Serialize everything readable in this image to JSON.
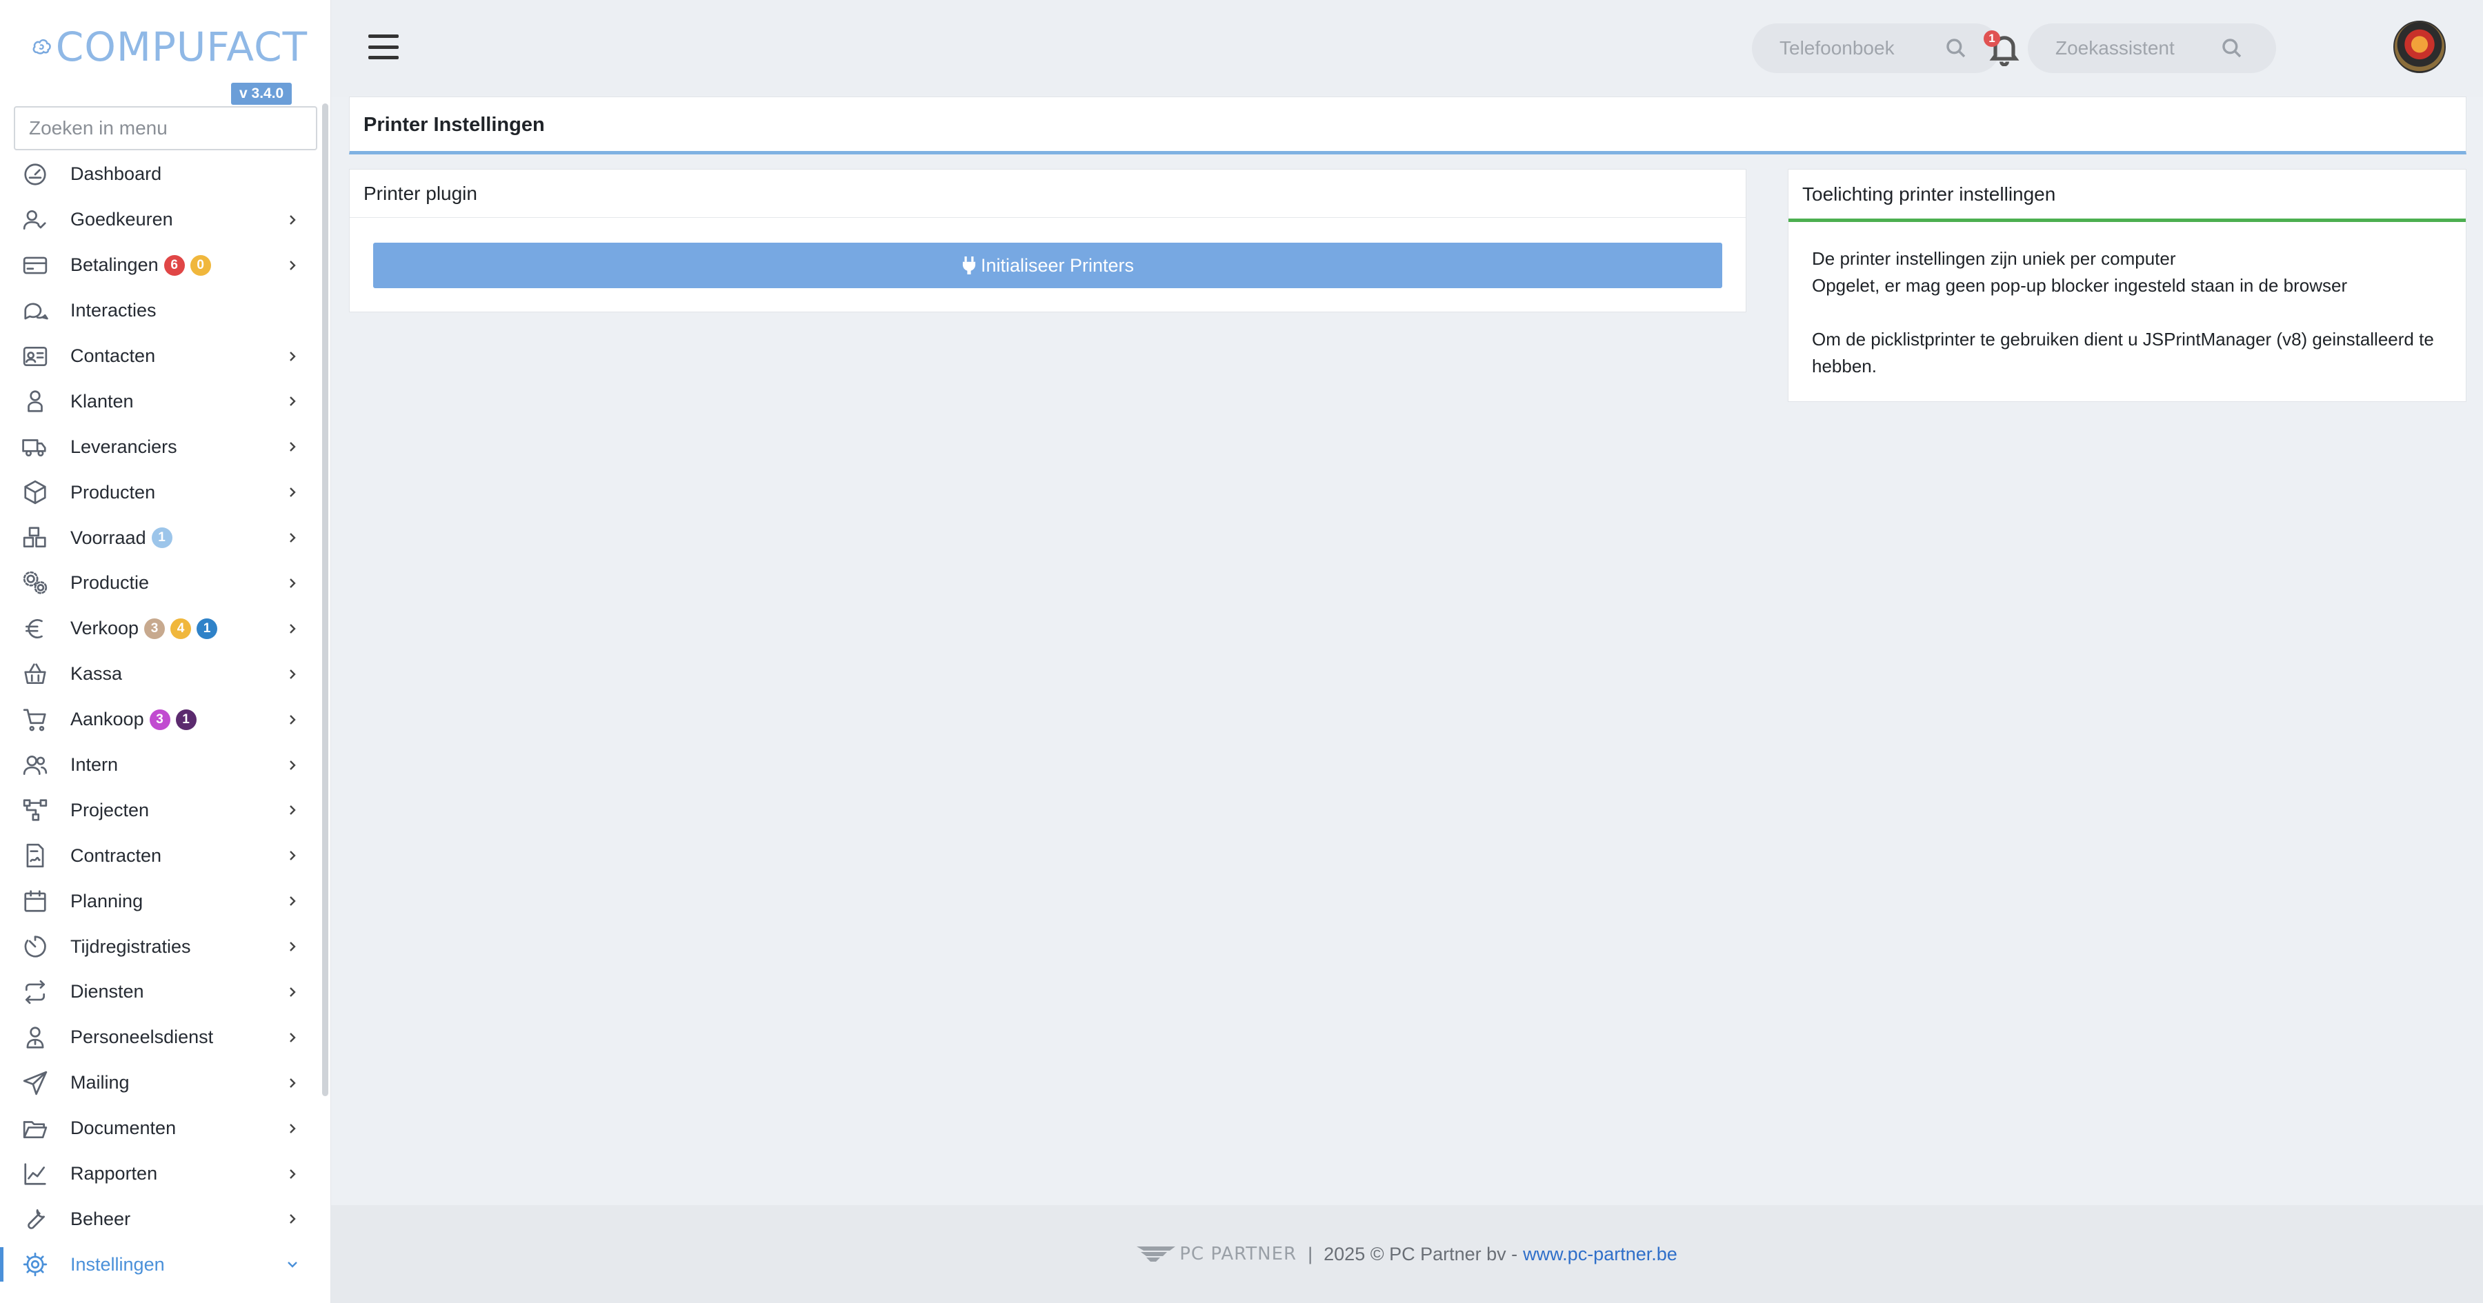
{
  "app": {
    "logo_text": "COMPUFACT",
    "version": "v 3.4.0"
  },
  "sidebar": {
    "search_placeholder": "Zoeken in menu",
    "items": [
      {
        "label": "Dashboard",
        "icon": "dashboard-gauge-icon",
        "chevron": false,
        "badges": []
      },
      {
        "label": "Goedkeuren",
        "icon": "user-check-icon",
        "chevron": true,
        "badges": []
      },
      {
        "label": "Betalingen",
        "icon": "credit-card-icon",
        "chevron": true,
        "badges": [
          {
            "text": "6",
            "color": "#e04646"
          },
          {
            "text": "0",
            "color": "#f0b73c"
          }
        ]
      },
      {
        "label": "Interacties",
        "icon": "chat-bubbles-icon",
        "chevron": false,
        "badges": []
      },
      {
        "label": "Contacten",
        "icon": "contact-card-icon",
        "chevron": true,
        "badges": []
      },
      {
        "label": "Klanten",
        "icon": "customer-icon",
        "chevron": true,
        "badges": []
      },
      {
        "label": "Leveranciers",
        "icon": "truck-icon",
        "chevron": true,
        "badges": []
      },
      {
        "label": "Producten",
        "icon": "box-icon",
        "chevron": true,
        "badges": []
      },
      {
        "label": "Voorraad",
        "icon": "stacked-boxes-icon",
        "chevron": true,
        "badges": [
          {
            "text": "1",
            "color": "#9cc5ea"
          }
        ]
      },
      {
        "label": "Productie",
        "icon": "gears-icon",
        "chevron": true,
        "badges": []
      },
      {
        "label": "Verkoop",
        "icon": "euro-icon",
        "chevron": true,
        "badges": [
          {
            "text": "3",
            "color": "#c7a98e"
          },
          {
            "text": "4",
            "color": "#f0b73c"
          },
          {
            "text": "1",
            "color": "#2f82c8"
          }
        ]
      },
      {
        "label": "Kassa",
        "icon": "basket-icon",
        "chevron": true,
        "badges": []
      },
      {
        "label": "Aankoop",
        "icon": "shopping-cart-icon",
        "chevron": true,
        "badges": [
          {
            "text": "3",
            "color": "#c14bd0"
          },
          {
            "text": "1",
            "color": "#5b2a6e"
          }
        ]
      },
      {
        "label": "Intern",
        "icon": "users-icon",
        "chevron": true,
        "badges": []
      },
      {
        "label": "Projecten",
        "icon": "project-nodes-icon",
        "chevron": true,
        "badges": []
      },
      {
        "label": "Contracten",
        "icon": "contract-icon",
        "chevron": true,
        "badges": []
      },
      {
        "label": "Planning",
        "icon": "calendar-icon",
        "chevron": true,
        "badges": []
      },
      {
        "label": "Tijdregistraties",
        "icon": "timer-icon",
        "chevron": true,
        "badges": []
      },
      {
        "label": "Diensten",
        "icon": "repeat-arrows-icon",
        "chevron": true,
        "badges": []
      },
      {
        "label": "Personeelsdienst",
        "icon": "employee-icon",
        "chevron": true,
        "badges": []
      },
      {
        "label": "Mailing",
        "icon": "paper-plane-icon",
        "chevron": true,
        "badges": []
      },
      {
        "label": "Documenten",
        "icon": "folder-open-icon",
        "chevron": true,
        "badges": []
      },
      {
        "label": "Rapporten",
        "icon": "line-chart-icon",
        "chevron": true,
        "badges": []
      },
      {
        "label": "Beheer",
        "icon": "wrench-icon",
        "chevron": true,
        "badges": []
      },
      {
        "label": "Instellingen",
        "icon": "gear-icon",
        "chevron": true,
        "badges": [],
        "active": true
      }
    ]
  },
  "topbar": {
    "phonebook_placeholder": "Telefoonboek",
    "assistant_placeholder": "Zoekassistent",
    "notification_count": "1"
  },
  "page": {
    "title": "Printer Instellingen"
  },
  "plugin_card": {
    "title": "Printer plugin",
    "button_label": "Initialiseer Printers"
  },
  "info_card": {
    "title": "Toelichting printer instellingen",
    "line1": "De printer instellingen zijn uniek per computer",
    "line2": "Opgelet, er mag geen pop-up blocker ingesteld staan in de browser",
    "line3": "Om de picklistprinter te gebruiken dient u JSPrintManager (v8) geinstalleerd te hebben."
  },
  "footer": {
    "brand": "PC PARTNER",
    "separator": "|",
    "copyright": "2025 © PC Partner bv -",
    "link": "www.pc-partner.be"
  },
  "colors": {
    "accent": "#4a90d9",
    "button": "#77a8e2",
    "header_underline": "#7fb1e2",
    "info_underline": "#4caf50"
  }
}
